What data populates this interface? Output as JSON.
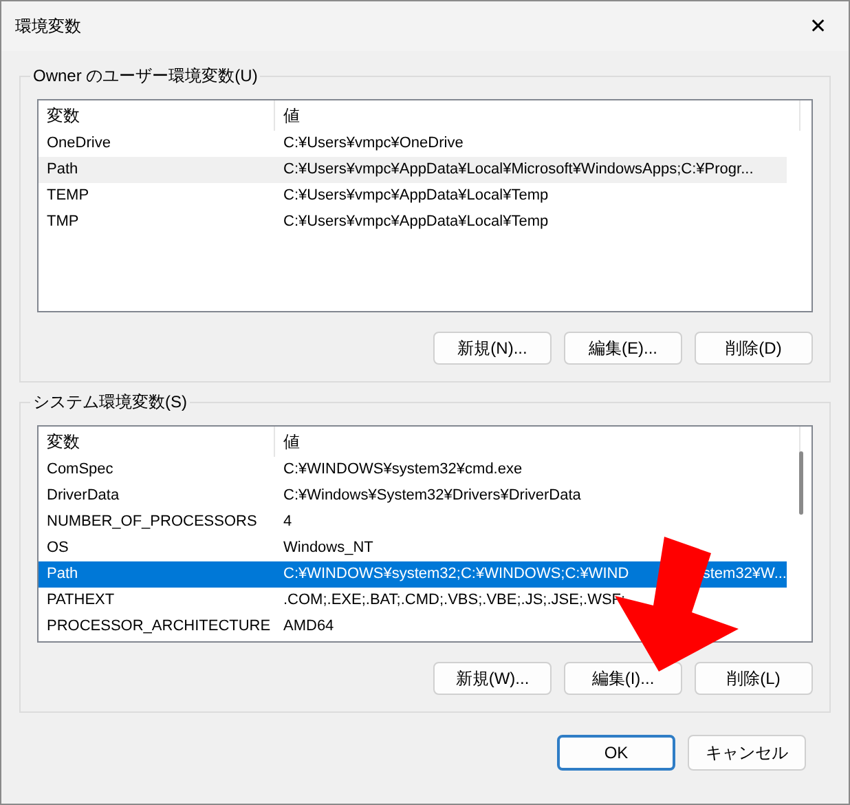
{
  "window": {
    "title": "環境変数",
    "close": "✕"
  },
  "groups": [
    {
      "label": "Owner のユーザー環境変数(U)",
      "focused": false,
      "columns": [
        "変数",
        "値"
      ],
      "rows": [
        {
          "name": "OneDrive",
          "value": "C:¥Users¥vmpc¥OneDrive",
          "selected": false
        },
        {
          "name": "Path",
          "value": "C:¥Users¥vmpc¥AppData¥Local¥Microsoft¥WindowsApps;C:¥Progr...",
          "selected": true
        },
        {
          "name": "TEMP",
          "value": "C:¥Users¥vmpc¥AppData¥Local¥Temp",
          "selected": false
        },
        {
          "name": "TMP",
          "value": "C:¥Users¥vmpc¥AppData¥Local¥Temp",
          "selected": false
        }
      ],
      "scrollbar": false,
      "buttons": [
        "新規(N)...",
        "編集(E)...",
        "削除(D)"
      ]
    },
    {
      "label": "システム環境変数(S)",
      "focused": true,
      "columns": [
        "変数",
        "値"
      ],
      "rows": [
        {
          "name": "ComSpec",
          "value": "C:¥WINDOWS¥system32¥cmd.exe",
          "selected": false
        },
        {
          "name": "DriverData",
          "value": "C:¥Windows¥System32¥Drivers¥DriverData",
          "selected": false
        },
        {
          "name": "NUMBER_OF_PROCESSORS",
          "value": "4",
          "selected": false
        },
        {
          "name": "OS",
          "value": "Windows_NT",
          "selected": false
        },
        {
          "name": "Path",
          "value": "C:¥WINDOWS¥system32;C:¥WINDOWS;C:¥WIND",
          "value_tail": "stem32¥W...",
          "selected": true
        },
        {
          "name": "PATHEXT",
          "value": ".COM;.EXE;.BAT;.CMD;.VBS;.VBE;.JS;.JSE;.WSF;",
          "selected": false
        },
        {
          "name": "PROCESSOR_ARCHITECTURE",
          "value": "AMD64",
          "selected": false
        }
      ],
      "scrollbar": true,
      "buttons": [
        "新規(W)...",
        "編集(I)...",
        "削除(L)"
      ]
    }
  ],
  "footer_buttons": [
    {
      "label": "OK",
      "default": true
    },
    {
      "label": "キャンセル",
      "default": false
    }
  ],
  "annotation": {
    "kind": "arrow"
  }
}
